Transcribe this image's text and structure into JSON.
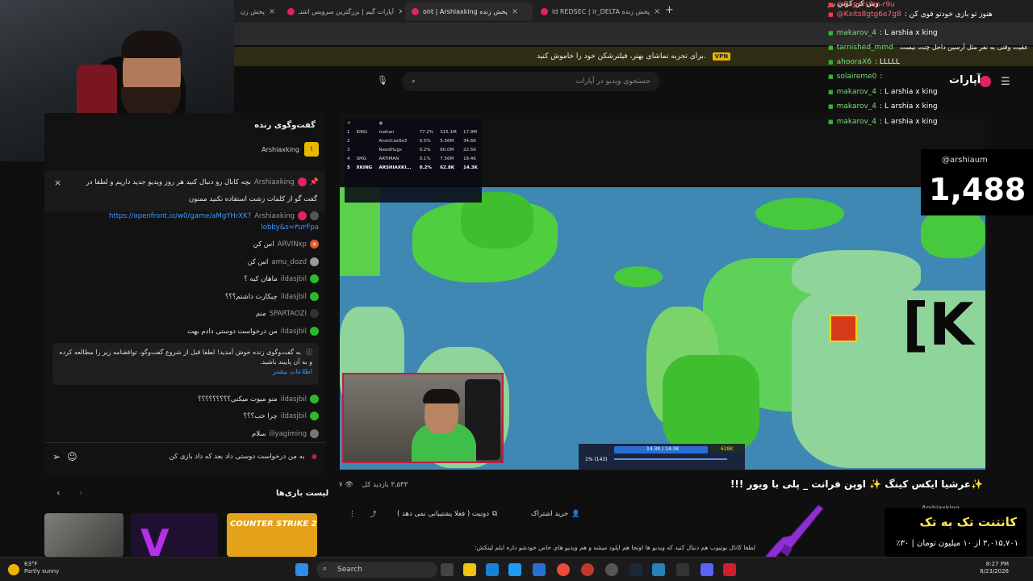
{
  "browser": {
    "tabs": [
      {
        "label": "پخش زن"
      },
      {
        "label": "آپارات گیم | بزرگترین سرویس اشتـ"
      },
      {
        "label": "ont | Arshiaxking پخش زنده"
      },
      {
        "label": "ld REDSEC | ir_DELTA پخش زنده"
      }
    ],
    "new_tab": "+",
    "close": "×"
  },
  "banner": {
    "vpn": "VPN",
    "text": "برای تجربه تماشای بهتر، فیلترشکن خود را خاموش کنید."
  },
  "header": {
    "search_placeholder": "جستجوی ویدیو در آپارات",
    "logo": "آپارات"
  },
  "chat": {
    "title": "گفت‌وگوی زنده",
    "top_donor": "Arshiaxking",
    "top_rank": "۱",
    "pinned": {
      "user": "Arshiaxking",
      "text": "بچه کانال رو دنبال کنید هر روز ویدیو جدید داریم و لطفا در",
      "text2": "گفت گو از کلمات زشت استفاده نکنید ممنون"
    },
    "link_msg": {
      "user": "Arshiaxking",
      "url": "https://openfront.io/w0/game/aMgYHrXK?",
      "url2": "lobby&s=۳u۲Fpa"
    },
    "messages": [
      {
        "user": "ARVINxp",
        "text": "اس کن"
      },
      {
        "user": "amu_dozd",
        "text": "اس کن"
      },
      {
        "user": "ildasjbil",
        "text": "ماهان کیه ؟"
      },
      {
        "user": "ildasjbil",
        "text": "چیکارت داشتم؟؟؟"
      },
      {
        "user": "SPARTAOZI",
        "text": "منم"
      },
      {
        "user": "ildasjbil",
        "text": "من درخواست دوستی دادم بهت"
      }
    ],
    "welcome": {
      "text": "به گفت‌وگوی زنده خوش آمدید! لطفا قبل از شروع گفت‌وگو، توافقنامه زیر را مطالعه کرده و به آن پایبند باشید.",
      "link": "اطلاعات بیشتر"
    },
    "messages2": [
      {
        "user": "ildasjbil",
        "text": "منو میوت میکنی؟؟؟؟؟؟؟؟؟"
      },
      {
        "user": "ildasjbil",
        "text": "چرا خب؟؟؟"
      },
      {
        "user": "iliyagiming",
        "text": "سلام"
      }
    ],
    "input_value": "به من درخواست دوستی داد بعد که داد بازی کن"
  },
  "games": {
    "title": "لیست بازی‌ها",
    "items": [
      "",
      "",
      "COUNTER STRIKE 2"
    ]
  },
  "leaderboard": {
    "rows": [
      {
        "rank": "1",
        "name": "KING",
        "player": "mahan",
        "pct": "77.2%",
        "troops": "315.1M",
        "gold": "17.9M"
      },
      {
        "rank": "2",
        "name": "",
        "player": "AnonCastle3",
        "pct": "0.5%",
        "troops": "5.56M",
        "gold": "34.6K"
      },
      {
        "rank": "3",
        "name": "",
        "player": "NeedHugs",
        "pct": "0.2%",
        "troops": "60.0M",
        "gold": "22.5K"
      },
      {
        "rank": "4",
        "name": "SMG",
        "player": "ARTIMAN",
        "pct": "0.1%",
        "troops": "7.56M",
        "gold": "18.4K"
      },
      {
        "rank": "5",
        "name": "XKING",
        "player": "ARSHIAXKI...",
        "pct": "0.2%",
        "troops": "62.8K",
        "gold": "14.3K"
      }
    ]
  },
  "overlay_chat": [
    {
      "user": "",
      "text": "وش کن کونی رو"
    },
    {
      "user": "@Bkpersian-r9u",
      "text": ""
    },
    {
      "user": "@Kxits8gtg6e7g8",
      "text": ": هنوز تو بازی خودتو قوی کن"
    },
    {
      "user": "makarov_4",
      "text": ": L arshia x king"
    },
    {
      "user": "",
      "text": "عقیت وقتی به نفر مثل آرسین داخل چنت نیست"
    },
    {
      "user": "tarnished_mmd",
      "text": ""
    },
    {
      "user": "ahooraX6",
      "text": ": LLLLL"
    },
    {
      "user": "solaireme0",
      "text": ":"
    },
    {
      "user": "makarov_4",
      "text": ": L arshia x king"
    },
    {
      "user": "makarov_4",
      "text": ": L arshia x king"
    },
    {
      "user": "makarov_4",
      "text": ": L arshia x king"
    }
  ],
  "viewer": {
    "name": "@arshiaum",
    "count": "1,488"
  },
  "bigK": "[K",
  "hud": {
    "troops": "14.3K / 14.3K",
    "gold": "628K",
    "pct": "1% (143)"
  },
  "video": {
    "title": "✨عرشیا ایکس کینگ ✨ اوپن فرانت _ پلی با ویور !!!",
    "views": "۳,۵۳۳ بازدید کل",
    "likes": "۷",
    "follow": "خرید اشتراک",
    "donate": "دونیت ( فعلا پشتیبانی نمی دهد )",
    "channel": "Arshiaxking",
    "desc": "لطفا کانال یوتیوب هم دنبال کنید که ویدیو ها اونجا هم اپلود میشه و هم ویدیو های خاص خودشو داره ایلم لینکش:"
  },
  "donate_overlay": {
    "title": "کانتنت تک به تک",
    "amount": "۳,۰۱۵,۷۰۱ از ۱۰ میلیون تومان | ۳۰٪"
  },
  "taskbar": {
    "temp": "63°F",
    "weather": "Partly sunny",
    "search": "Search",
    "time": "8:27 PM",
    "date": "8/23/2026"
  },
  "colors": {
    "accent": "#e0245e",
    "land": "#46c93c",
    "sea": "#3f88b3",
    "gold": "#e6b800"
  }
}
